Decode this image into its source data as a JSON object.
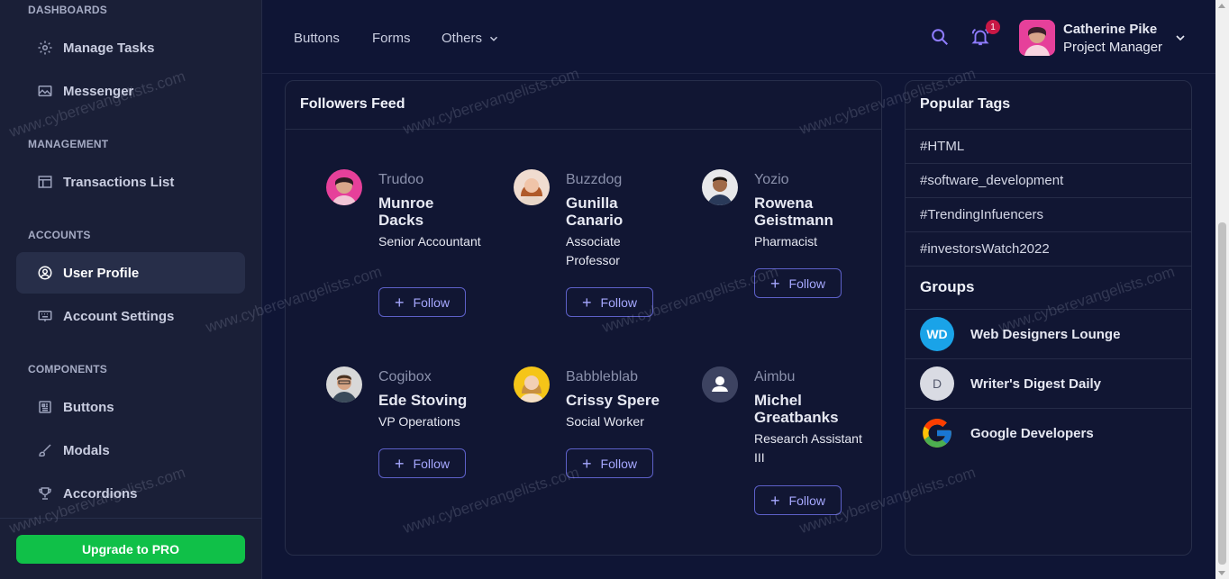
{
  "sidebar": {
    "sections": {
      "dashboards": "DASHBOARDS",
      "management": "MANAGEMENT",
      "accounts": "ACCOUNTS",
      "components": "COMPONENTS"
    },
    "items": [
      {
        "label": "Manage Tasks",
        "icon": "gear-icon"
      },
      {
        "label": "Messenger",
        "icon": "image-icon"
      },
      {
        "label": "Transactions List",
        "icon": "table-icon"
      },
      {
        "label": "User Profile",
        "icon": "user-circle-icon",
        "active": true
      },
      {
        "label": "Account Settings",
        "icon": "keyboard-icon"
      },
      {
        "label": "Buttons",
        "icon": "buttons-icon"
      },
      {
        "label": "Modals",
        "icon": "brush-icon"
      },
      {
        "label": "Accordions",
        "icon": "trophy-icon"
      }
    ],
    "upgrade_label": "Upgrade to PRO"
  },
  "topbar": {
    "links": [
      "Buttons",
      "Forms",
      "Others"
    ],
    "notification_count": "1",
    "user": {
      "name": "Catherine Pike",
      "role": "Project Manager"
    }
  },
  "followers_feed": {
    "title": "Followers Feed",
    "follow_label": "Follow",
    "followers": [
      {
        "company": "Trudoo",
        "name": "Munroe Dacks",
        "role": "Senior Accountant"
      },
      {
        "company": "Buzzdog",
        "name": "Gunilla Canario",
        "role": "Associate Professor"
      },
      {
        "company": "Yozio",
        "name": "Rowena Geistmann",
        "role": "Pharmacist"
      },
      {
        "company": "Cogibox",
        "name": "Ede Stoving",
        "role": "VP Operations"
      },
      {
        "company": "Babbleblab",
        "name": "Crissy Spere",
        "role": "Social Worker"
      },
      {
        "company": "Aimbu",
        "name": "Michel Greatbanks",
        "role": "Research Assistant III"
      }
    ]
  },
  "popular_tags": {
    "title": "Popular Tags",
    "tags": [
      "#HTML",
      "#software_development",
      "#TrendingInfuencers",
      "#investorsWatch2022"
    ]
  },
  "groups": {
    "title": "Groups",
    "items": [
      {
        "initials": "WD",
        "name": "Web Designers Lounge",
        "color": "#1aa3e8"
      },
      {
        "initials": "D",
        "name": "Writer's Digest Daily",
        "color": "#d9dbe3"
      },
      {
        "initials": "",
        "name": "Google Developers",
        "color": ""
      }
    ]
  },
  "watermark": "www.cyberevangelists.com",
  "colors": {
    "accent": "#5d60c8",
    "upgrade": "#10c048",
    "background": "#0f1535"
  }
}
